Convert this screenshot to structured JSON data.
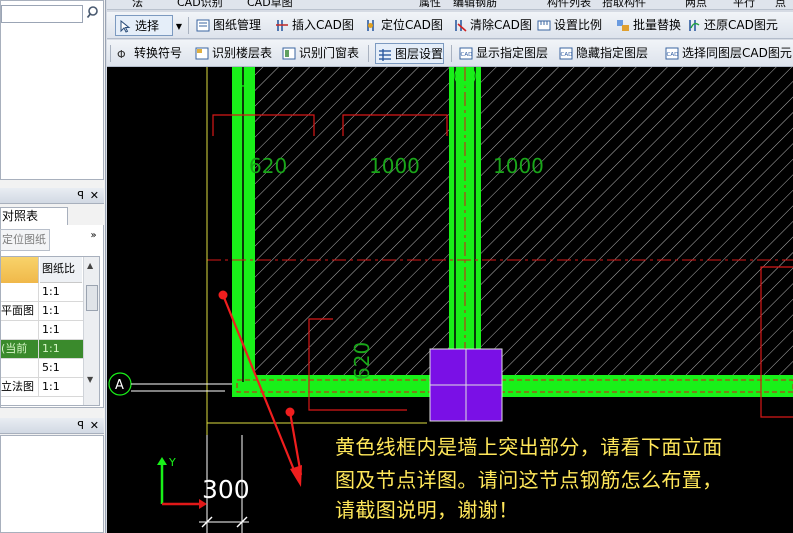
{
  "top_strip": [
    "法",
    "CAD识别",
    "CAD草图",
    "属性",
    "编辑钢筋",
    "构件列表",
    "拾取构件",
    "两点",
    "平行",
    "点"
  ],
  "toolbar1": {
    "select": "选择",
    "items": [
      "图纸管理",
      "插入CAD图",
      "定位CAD图",
      "清除CAD图",
      "设置比例",
      "批量替换",
      "还原CAD图元"
    ]
  },
  "toolbar2": {
    "items": [
      "转换符号",
      "识别楼层表",
      "识别门窗表",
      "图层设置",
      "显示指定图层",
      "隐藏指定图层",
      "选择同图层CAD图元"
    ]
  },
  "left_panel": {
    "tab_label": "对照表",
    "locate_button": "定位图纸",
    "more_button": "»",
    "grid_header": "图纸比",
    "rows": [
      {
        "name": "",
        "scale": "1:1"
      },
      {
        "name": "平面图",
        "scale": "1:1"
      },
      {
        "name": "",
        "scale": "1:1"
      },
      {
        "name": "(当前",
        "scale": "1:1"
      },
      {
        "name": "",
        "scale": "5:1"
      },
      {
        "name": "立法图",
        "scale": "1:1"
      }
    ]
  },
  "canvas": {
    "dims": [
      "620",
      "1000",
      "1000",
      "620",
      "300"
    ],
    "axis_a": "A",
    "axis_y": "Y",
    "note_lines": [
      "黄色线框内是墙上突出部分，请看下面立面",
      "图及节点详图。请问这节点钢筋怎么布置，",
      "请截图说明，谢谢！"
    ]
  },
  "colors": {
    "wall_green": "#19f019",
    "column_purple": "#7a10e6",
    "dim_red": "#e01818",
    "annotation_red": "#f01e1e",
    "note_yellow": "#ffe75a",
    "highlight_yellow": "#dede40"
  }
}
